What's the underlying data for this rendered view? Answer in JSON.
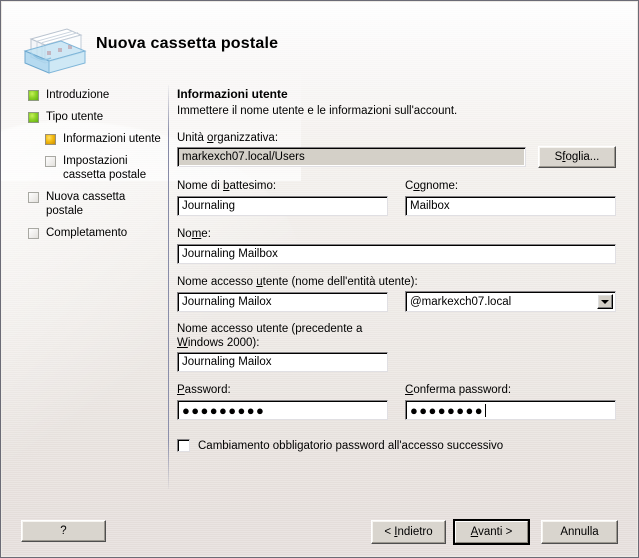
{
  "window": {
    "title": "Nuova cassetta postale",
    "icon": "mailbox-tray-icon"
  },
  "sidebar": {
    "items": [
      {
        "label": "Introduzione",
        "state": "done",
        "name": "sidebar-item-introduzione"
      },
      {
        "label": "Tipo utente",
        "state": "done",
        "name": "sidebar-item-tipo-utente"
      },
      {
        "label": "Informazioni utente",
        "state": "current",
        "name": "sidebar-item-informazioni-utente"
      },
      {
        "label": "Impostazioni\ncassetta postale",
        "state": "pending",
        "name": "sidebar-item-impostazioni-cassetta-postale"
      },
      {
        "label": "Nuova cassetta\npostale",
        "state": "pending",
        "name": "sidebar-item-nuova-cassetta-postale"
      },
      {
        "label": "Completamento",
        "state": "pending",
        "name": "sidebar-item-completamento"
      }
    ]
  },
  "pane": {
    "title": "Informazioni utente",
    "subtitle": "Immettere il nome utente e le informazioni sull'account."
  },
  "fields": {
    "ou": {
      "label_pre": "Unità ",
      "label_acc": "o",
      "label_post": "rganizzativa:",
      "value": "markexch07.local/Users",
      "disabled": true
    },
    "browse_button": {
      "label_pre": "S",
      "label_acc": "f",
      "label_post": "oglia..."
    },
    "first_name": {
      "label_pre": "Nome di ",
      "label_acc": "b",
      "label_post": "attesimo:",
      "value": "Journaling"
    },
    "last_name": {
      "label_pre": "C",
      "label_acc": "o",
      "label_post": "gnome:",
      "value": "Mailbox"
    },
    "display_name": {
      "label_pre": "No",
      "label_acc": "m",
      "label_post": "e:",
      "value": "Journaling Mailbox"
    },
    "upn": {
      "label_pre": "Nome accesso ",
      "label_acc": "u",
      "label_post": "tente (nome dell'entità utente):",
      "value": "Journaling Mailox"
    },
    "upn_suffix": {
      "value": "@markexch07.local",
      "options": [
        "@markexch07.local"
      ]
    },
    "sam": {
      "label_pre": "Nome accesso utente (precedente a\n",
      "label_acc": "W",
      "label_post": "indows 2000):",
      "value": "Journaling Mailox"
    },
    "password": {
      "label_pre": "",
      "label_acc": "P",
      "label_post": "assword:",
      "value": "●●●●●●●●●"
    },
    "confirm_password": {
      "label_pre": "",
      "label_acc": "C",
      "label_post": "onferma password:",
      "value": "●●●●●●●●",
      "focused": true
    },
    "must_change": {
      "label": "Cambiamento obbligatorio password all'accesso successivo",
      "checked": false
    }
  },
  "buttons": {
    "help": "?",
    "back": "< Indietro",
    "back_pre": "< ",
    "back_acc": "I",
    "back_post": "ndietro",
    "next": "Avanti >",
    "next_acc": "A",
    "next_post": "vanti >",
    "cancel": "Annulla"
  },
  "colors": {
    "step_done": "#8fd327",
    "step_current": "#f4bb10",
    "step_pending": "#e3e1dd",
    "dialog_bg": "#ece9e4",
    "separator": "#8b8fab",
    "field_bg": "#ffffff",
    "field_disabled_bg": "#d4d0c8"
  }
}
